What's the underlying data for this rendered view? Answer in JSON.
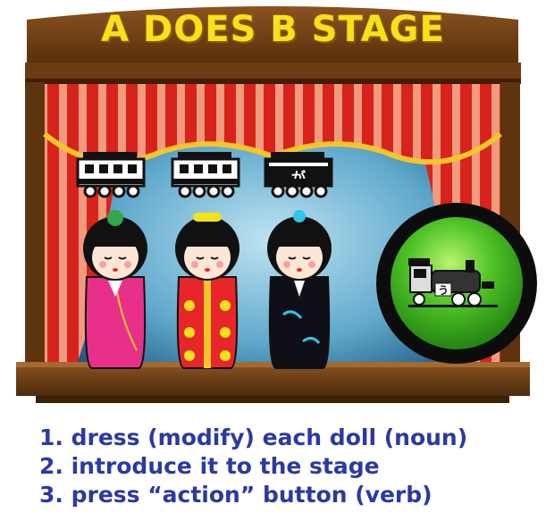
{
  "stage": {
    "title": "A DOES B STAGE"
  },
  "trains": [
    {
      "label": ""
    },
    {
      "label": ""
    },
    {
      "label": "が"
    }
  ],
  "action_button": {
    "locomotive_label": "う",
    "icon": "locomotive-icon",
    "color": "#3fb71f"
  },
  "dolls": [
    {
      "kimono_color": "#e8308a",
      "hair_ornament": "green-flower"
    },
    {
      "kimono_color": "#e8262a",
      "hair_ornament": "yellow-flowers"
    },
    {
      "kimono_color": "#0f0f18",
      "hair_ornament": "cyan-flower"
    }
  ],
  "instructions": [
    "1. dress (modify) each doll (noun)",
    "2. introduce it to the stage",
    "3. press “action” button (verb)"
  ],
  "colors": {
    "wood": "#7a4616",
    "curtain": "#d8231c",
    "gold": "#f3c62a",
    "text_blue": "#2a3aa0"
  }
}
